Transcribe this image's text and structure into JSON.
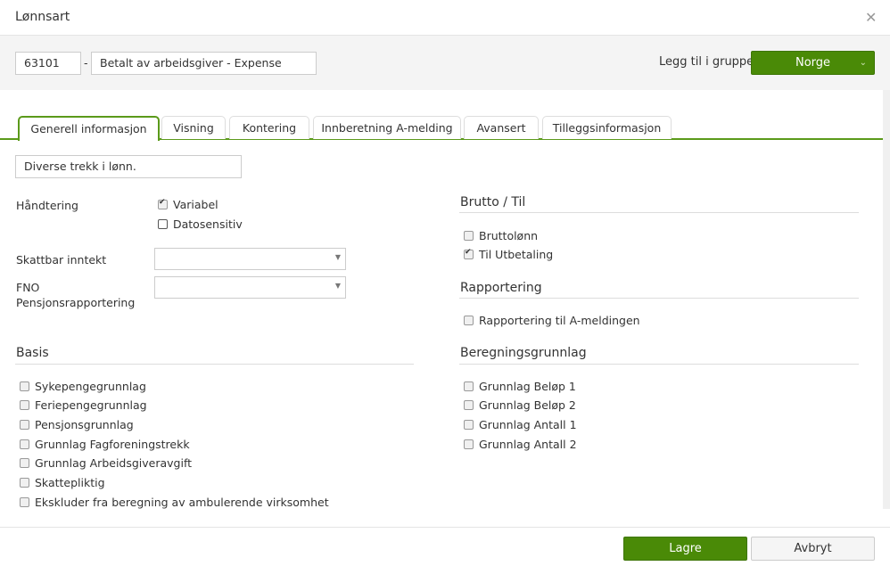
{
  "dialog": {
    "title": "Lønnsart",
    "close_icon": "close-icon"
  },
  "header": {
    "code": "63101",
    "separator": "-",
    "name": "Betalt av arbeidsgiver - Expense",
    "group_label": "Legg til i gruppe",
    "group_value": "Norge"
  },
  "tabs": [
    "Generell informasjon",
    "Visning",
    "Kontering",
    "Innberetning A-melding",
    "Avansert",
    "Tilleggsinformasjon"
  ],
  "description": "Diverse trekk i lønn.",
  "handtering": {
    "label": "Håndtering",
    "options": [
      {
        "label": "Variabel",
        "checked": true
      },
      {
        "label": "Datosensitiv",
        "checked": false
      }
    ]
  },
  "skattbar": {
    "label": "Skattbar inntekt",
    "value": ""
  },
  "fno": {
    "label1": "FNO",
    "label2": "Pensjonsrapportering",
    "value": ""
  },
  "basis": {
    "title": "Basis",
    "items": [
      {
        "label": "Sykepengegrunnlag",
        "checked": false
      },
      {
        "label": "Feriepengegrunnlag",
        "checked": false
      },
      {
        "label": "Pensjonsgrunnlag",
        "checked": false
      },
      {
        "label": "Grunnlag Fagforeningstrekk",
        "checked": false
      },
      {
        "label": "Grunnlag Arbeidsgiveravgift",
        "checked": false
      },
      {
        "label": "Skattepliktig",
        "checked": false
      },
      {
        "label": "Ekskluder fra beregning av ambulerende virksomhet",
        "checked": false
      }
    ]
  },
  "brutto": {
    "title": "Brutto / Til",
    "items": [
      {
        "label": "Bruttolønn",
        "checked": false
      },
      {
        "label": "Til Utbetaling",
        "checked": true
      }
    ]
  },
  "rapportering": {
    "title": "Rapportering",
    "items": [
      {
        "label": "Rapportering til A-meldingen",
        "checked": false
      }
    ]
  },
  "beregning": {
    "title": "Beregningsgrunnlag",
    "items": [
      {
        "label": "Grunnlag Beløp 1",
        "checked": false
      },
      {
        "label": "Grunnlag Beløp 2",
        "checked": false
      },
      {
        "label": "Grunnlag Antall 1",
        "checked": false
      },
      {
        "label": "Grunnlag Antall 2",
        "checked": false
      }
    ]
  },
  "footer": {
    "save": "Lagre",
    "cancel": "Avbryt"
  }
}
